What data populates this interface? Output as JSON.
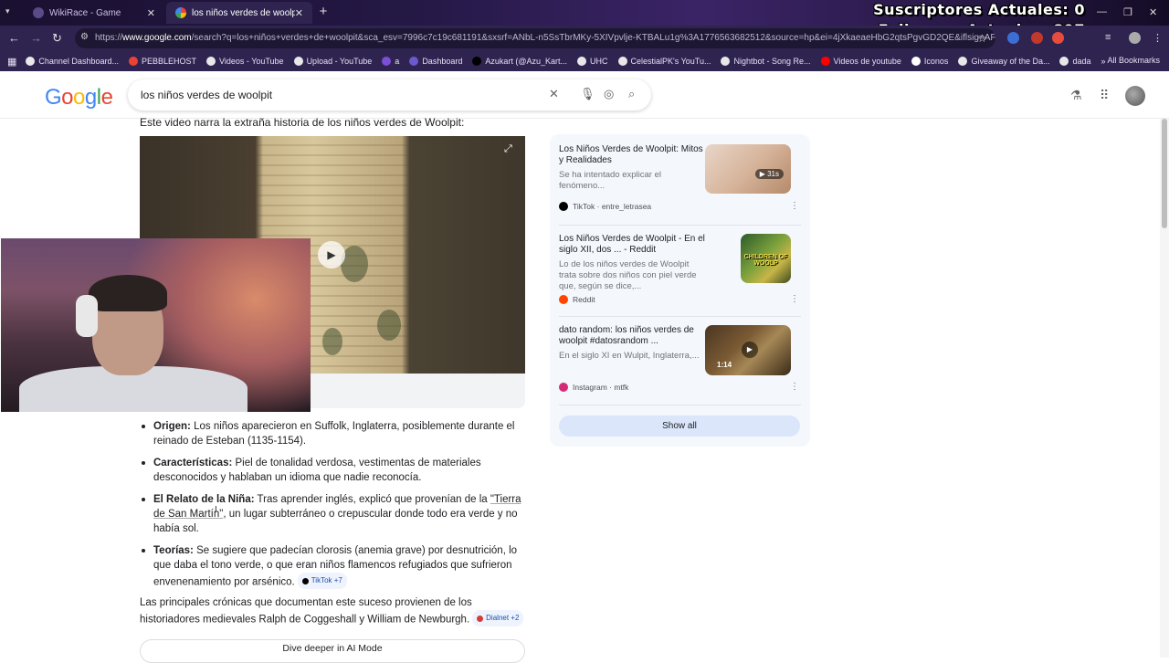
{
  "browser": {
    "tabs": [
      {
        "title": "WikiRace - Game",
        "active": false
      },
      {
        "title": "los niños verdes de woolpit - G",
        "active": true
      }
    ],
    "url_prefix": "https://",
    "url_host": "www.google.com",
    "url_rest": "/search?q=los+niños+verdes+de+woolpit&sca_esv=7996c7c19c681191&sxsrf=ANbL-n5SsTbrMKy-5XIVpvlje-KTBALu1g%3A1776563682512&source=hp&ei=4jXkaeaeHbG2qtsPgvGD2QE&iflsig=AFdpzrgAA...",
    "bookmarks": [
      {
        "label": "Channel Dashboard...",
        "color": "#e8e8e8"
      },
      {
        "label": "PEBBLEHOST",
        "color": "#ea4335"
      },
      {
        "label": "Videos - YouTube",
        "color": "#e8e8e8"
      },
      {
        "label": "Upload - YouTube",
        "color": "#e8e8e8"
      },
      {
        "label": "a",
        "color": "#7b4fd6"
      },
      {
        "label": "Dashboard",
        "color": "#6a5acd"
      },
      {
        "label": "Azukart (@Azu_Kart...",
        "color": "#000000"
      },
      {
        "label": "UHC",
        "color": "#e8e8e8"
      },
      {
        "label": "CelestialPK's YouTu...",
        "color": "#e8e8e8"
      },
      {
        "label": "Nightbot - Song Re...",
        "color": "#e8e8e8"
      },
      {
        "label": "Videos de youtube",
        "color": "#ff0000"
      },
      {
        "label": "Iconos",
        "color": "#ffffff"
      },
      {
        "label": "Giveaway of the Da...",
        "color": "#e8e8e8"
      },
      {
        "label": "dada",
        "color": "#e8e8e8"
      }
    ],
    "all_bookmarks": "All Bookmarks"
  },
  "stream_overlay": {
    "line1": "Suscriptores Actuales: 0",
    "line2": "Followers Actuales: 897"
  },
  "google": {
    "logo": "Google",
    "query": "los niños verdes de woolpit"
  },
  "ai_overview": {
    "intro": "Este video narra la extraña historia de los niños verdes de Woolpit:",
    "bullets": [
      {
        "label": "Origen:",
        "text": " Los niños aparecieron en Suffolk, Inglaterra, posiblemente durante el reinado de Esteban (1135-1154)."
      },
      {
        "label": "Características:",
        "text": " Piel de tonalidad verdosa, vestimentas de materiales desconocidos y hablaban un idioma que nadie reconocía."
      },
      {
        "label": "El Relato de la Niña:",
        "text_before": " Tras aprender inglés, explicó que provenían de la ",
        "link": "\"Tierra de San Martín\"",
        "text_after": ", un lugar subterráneo o crepuscular donde todo era verde y no había sol."
      },
      {
        "label": "Teorías:",
        "text": " Se sugiere que padecían clorosis (anemia grave) por desnutrición, lo que daba el tono verde, o que eran niños flamencos refugiados que sufrieron envenenamiento por arsénico.",
        "chip": "TikTok +7"
      }
    ],
    "closing": "Las principales crónicas que documentan este suceso provienen de los historiadores medievales Ralph de Coggeshall y William de Newburgh.",
    "closing_chip": "Dialnet +2",
    "dive_button": "Dive deeper in AI Mode"
  },
  "side_panel": {
    "cards": [
      {
        "title": "Los Niños Verdes de Woolpit: Mitos y Realidades",
        "snippet": "Se ha intentado explicar el fenómeno...",
        "source": "TikTok",
        "author": "entre_letrasea",
        "badge": "▶ 31s",
        "icon_color": "#000000"
      },
      {
        "title": "Los Niños Verdes de Woolpit - En el siglo XII, dos ... - Reddit",
        "snippet": "Lo de los niños verdes de Woolpit trata sobre dos niños con piel verde que, según se dice,...",
        "source": "Reddit",
        "author": "",
        "thumb_text": "CHILDREN OF WOOLP",
        "icon_color": "#ff4500"
      },
      {
        "title": "dato random: los niños verdes de woolpit #datosrandom ...",
        "snippet": "En el siglo XI en Wulpit, Inglaterra,...",
        "source": "Instagram",
        "author": "mtfk",
        "badge": "1:14",
        "icon_color": "#d62976"
      }
    ],
    "show_all": "Show all"
  }
}
